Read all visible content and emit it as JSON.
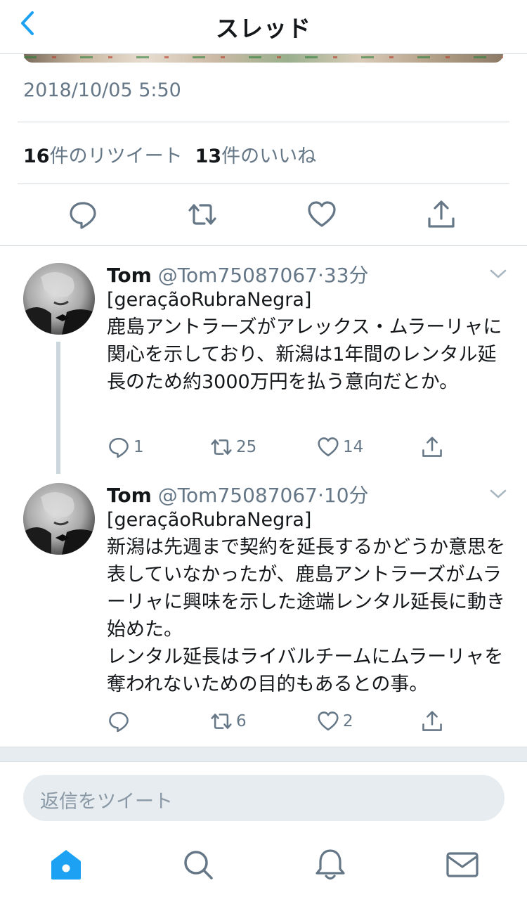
{
  "header": {
    "title": "スレッド",
    "back_icon": "chevron-left-icon"
  },
  "focused_tweet": {
    "timestamp": "2018/10/05 5:50",
    "retweet_count": "16",
    "retweet_label": "件のリツイート",
    "like_count": "13",
    "like_label": "件のいいね"
  },
  "replies": [
    {
      "name": "Tom",
      "handle": "@Tom75087067",
      "sep": "·",
      "time": "33分",
      "text": "[geraçãoRubraNegra]\n鹿島アントラーズがアレックス・ムラーリャに関心を示しており、新潟は1年間のレンタル延長のため約3000万円を払う意向だとか。",
      "reply_count": "1",
      "retweet_count": "25",
      "like_count": "14"
    },
    {
      "name": "Tom",
      "handle": "@Tom75087067",
      "sep": "·",
      "time": "10分",
      "text": "[geraçãoRubraNegra]\n新潟は先週まで契約を延長するかどうか意思を表していなかったが、鹿島アントラーズがムラーリャに興味を示した途端レンタル延長に動き始めた。\nレンタル延長はライバルチームにムラーリャを奪われないための目的もあるとの事。",
      "reply_count": "",
      "retweet_count": "6",
      "like_count": "2"
    }
  ],
  "reply_box": {
    "placeholder": "返信をツイート"
  },
  "colors": {
    "accent": "#1da1f2",
    "secondary_text": "#657786",
    "icon": "#657786",
    "divider": "#d6dbe0"
  },
  "tabbar": {
    "icons": [
      "home-icon",
      "search-icon",
      "notifications-icon",
      "messages-icon"
    ]
  }
}
